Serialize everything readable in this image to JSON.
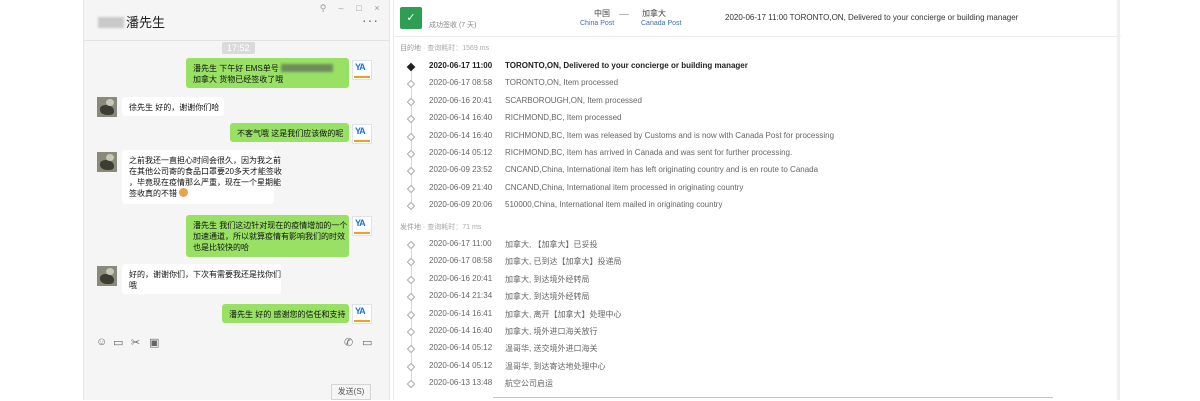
{
  "chat": {
    "contact_name": "潘先生",
    "header_buttons": [
      "⚲",
      "–",
      "□",
      "×"
    ],
    "more": "···",
    "timestamp": "17:52",
    "messages": [
      {
        "side": "me",
        "lines": [
          "潘先生 下午好 EMS单号",
          "加拿大 货物已经签收了哦"
        ],
        "has_blur": true
      },
      {
        "side": "other",
        "lines": [
          "徐先生 好的，谢谢你们哈"
        ]
      },
      {
        "side": "me",
        "lines": [
          "不客气哦 这是我们应该做的呢"
        ]
      },
      {
        "side": "other",
        "lines": [
          "之前我还一直担心时间会很久，因为我之前",
          "在其他公司寄的食品口罩要20多天才能签收",
          "，毕竟现在疫情那么严重，现在一个星期能",
          "签收真的不错"
        ],
        "has_emoji": true
      },
      {
        "side": "me",
        "lines": [
          "潘先生 我们这边针对现在的疫情增加的一个",
          "加速通道，所以就算疫情有影响我们的时效",
          "也是比较快的哈"
        ]
      },
      {
        "side": "other",
        "lines": [
          "好的，谢谢你们，下次有需要我还是找你们",
          "哦"
        ]
      },
      {
        "side": "me",
        "lines": [
          "潘先生 好的 感谢您的信任和支持"
        ]
      }
    ],
    "logo_mark": "YA",
    "toolbar_icons": [
      "☺",
      "▭",
      "✂",
      "▣"
    ],
    "toolbar_right_icons": [
      "✆",
      "▭"
    ],
    "send_label": "发送(S)"
  },
  "tracking": {
    "status_icon": "✓",
    "status_text": "成功签收 (7 天)",
    "origin_country": "中国",
    "origin_post": "China Post",
    "dest_country": "加拿大",
    "dest_post": "Canada Post",
    "latest_event": "2020-06-17 11:00   TORONTO,ON, Delivered to your concierge or building manager",
    "dest_section_label": "目的地",
    "dest_section_query": "· 查询耗时：1569 ms",
    "dest_events": [
      {
        "time": "2020-06-17 11:00",
        "desc": "TORONTO,ON, Delivered to your concierge or building manager"
      },
      {
        "time": "2020-06-17 08:58",
        "desc": "TORONTO,ON, Item processed"
      },
      {
        "time": "2020-06-16 20:41",
        "desc": "SCARBOROUGH,ON, Item processed"
      },
      {
        "time": "2020-06-14 16:40",
        "desc": "RICHMOND,BC, Item processed"
      },
      {
        "time": "2020-06-14 16:40",
        "desc": "RICHMOND,BC, Item was released by Customs and is now with Canada Post for processing"
      },
      {
        "time": "2020-06-14 05:12",
        "desc": "RICHMOND,BC, Item has arrived in Canada and was sent for further processing."
      },
      {
        "time": "2020-06-09 23:52",
        "desc": "CNCAND,China, International item has left originating country and is en route to Canada"
      },
      {
        "time": "2020-06-09 21:40",
        "desc": "CNCAND,China, International item processed in originating country"
      },
      {
        "time": "2020-06-09 20:06",
        "desc": "510000,China, International item mailed in originating country"
      }
    ],
    "origin_section_label": "发件地",
    "origin_section_query": "· 查询耗时：71 ms",
    "origin_events": [
      {
        "time": "2020-06-17 11:00",
        "desc": "加拿大, 【加拿大】已妥投"
      },
      {
        "time": "2020-06-17 08:58",
        "desc": "加拿大, 已到达【加拿大】投递局"
      },
      {
        "time": "2020-06-16 20:41",
        "desc": "加拿大, 到达境外经转局"
      },
      {
        "time": "2020-06-14 21:34",
        "desc": "加拿大, 到达境外经转局"
      },
      {
        "time": "2020-06-14 16:41",
        "desc": "加拿大, 离开【加拿大】处理中心"
      },
      {
        "time": "2020-06-14 16:40",
        "desc": "加拿大, 境外进口海关放行"
      },
      {
        "time": "2020-06-14 05:12",
        "desc": "温哥华, 送交境外进口海关"
      },
      {
        "time": "2020-06-14 05:12",
        "desc": "温哥华, 到达寄达地处理中心"
      },
      {
        "time": "2020-06-13 13:48",
        "desc": "航空公司启运"
      }
    ]
  }
}
